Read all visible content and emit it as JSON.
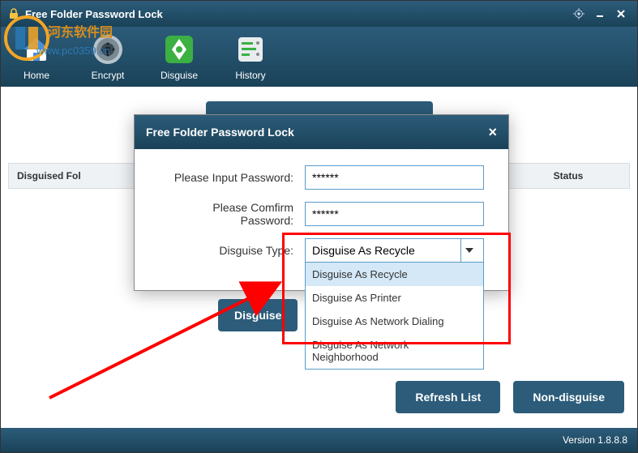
{
  "app": {
    "title": "Free Folder Password Lock",
    "version_label": "Version 1.8.8.8"
  },
  "watermark": {
    "line1": "河东软件园",
    "line2": "www.pc0359.cn"
  },
  "toolbar": {
    "home": "Home",
    "encrypt": "Encrypt",
    "disguise": "Disguise",
    "history": "History"
  },
  "table": {
    "col_folder": "Disguised Fol",
    "col_status": "Status"
  },
  "dialog": {
    "title": "Free Folder Password Lock",
    "pwd_label": "Please Input Password:",
    "pwd_value": "******",
    "confirm_label": "Please Comfirm Password:",
    "confirm_value": "******",
    "type_label": "Disguise Type:",
    "type_selected": "Disguise As Recycle",
    "options": [
      "Disguise As Recycle",
      "Disguise As Printer",
      "Disguise As Network Dialing",
      "Disguise As Network Neighborhood"
    ],
    "disguise_btn": "Disguise"
  },
  "footer": {
    "refresh": "Refresh List",
    "non_disguise": "Non-disguise"
  }
}
